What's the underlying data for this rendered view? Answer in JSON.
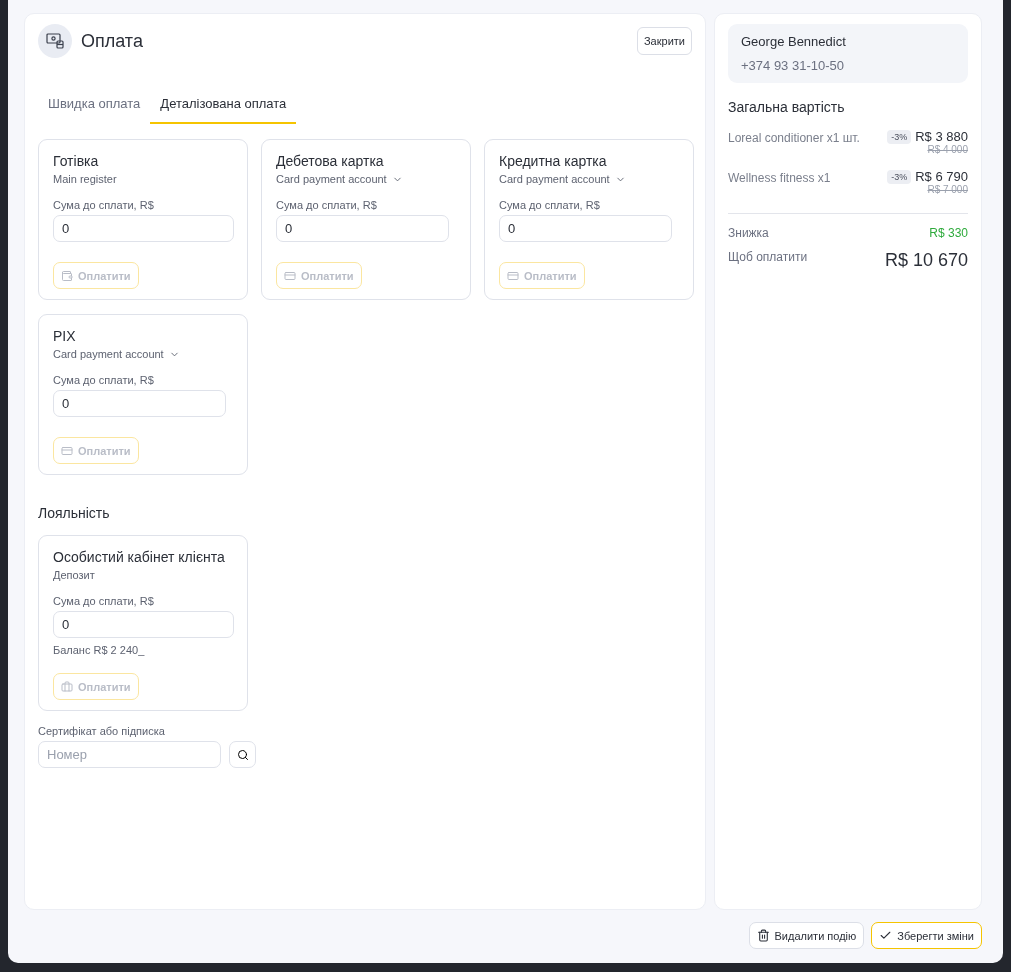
{
  "title": "Оплата",
  "close_button": "Закрити",
  "tabs": [
    {
      "label": "Швидка оплата",
      "selected": false
    },
    {
      "label": "Деталізована оплата",
      "selected": true
    }
  ],
  "methods": [
    {
      "name": "Готівка",
      "account": "Main register",
      "dropdown": false,
      "kind": "cash",
      "amount_label": "Сума до сплати, R$",
      "value": "0",
      "pay_label": "Оплатити",
      "disabled": true
    },
    {
      "name": "Дебетова картка",
      "account": "Card payment account",
      "dropdown": true,
      "kind": "card",
      "amount_label": "Сума до сплати, R$",
      "value": "0",
      "pay_label": "Оплатити",
      "disabled": true
    },
    {
      "name": "Кредитна картка",
      "account": "Card payment account",
      "dropdown": true,
      "kind": "card",
      "amount_label": "Сума до сплати, R$",
      "value": "0",
      "pay_label": "Оплатити",
      "disabled": true
    },
    {
      "name": "PIX",
      "account": "Card payment account",
      "dropdown": true,
      "kind": "card",
      "amount_label": "Сума до сплати, R$",
      "value": "0",
      "pay_label": "Оплатити",
      "disabled": true
    }
  ],
  "loyalty": {
    "heading": "Лояльність",
    "cards": [
      {
        "name": "Особистий кабінет клієнта",
        "subtitle": "Депозит",
        "amount_label": "Сума до сплати, R$",
        "value": "0",
        "balance": "Баланс R$ 2 240_",
        "pay_label": "Оплатити",
        "disabled": true
      }
    ]
  },
  "certificate": {
    "label": "Сертифікат або підписка",
    "placeholder": "Номер"
  },
  "customer": {
    "name": "George Bennedict",
    "phone": "+374 93 31-10-50"
  },
  "summary": {
    "heading": "Загальна вартість",
    "items": [
      {
        "name": "Loreal conditioner  x1 шт.",
        "discount": "-3%",
        "price": "R$ 3 880",
        "old_price": "R$ 4 000"
      },
      {
        "name": "Wellness fitness  x1",
        "discount": "-3%",
        "price": "R$ 6 790",
        "old_price": "R$ 7 000"
      }
    ],
    "discount_label": "Знижка",
    "discount_value": "R$ 330",
    "total_label": "Щоб оплатити",
    "total_value": "R$ 10 670"
  },
  "footer_buttons": [
    {
      "label": "Видалити подію",
      "kind": "delete"
    },
    {
      "label": "Зберегти зміни",
      "kind": "save"
    }
  ]
}
